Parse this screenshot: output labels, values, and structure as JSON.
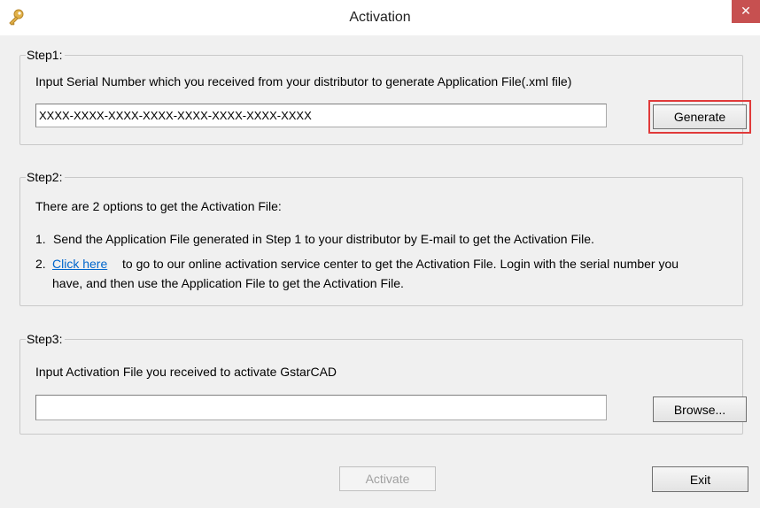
{
  "window": {
    "title": "Activation",
    "close_glyph": "✕",
    "icon": "key-icon"
  },
  "step1": {
    "legend": "Step1:",
    "instruction": "Input Serial Number which you received from your distributor to generate Application File(.xml file)",
    "serial_value": "XXXX-XXXX-XXXX-XXXX-XXXX-XXXX-XXXX-XXXX",
    "generate_label": "Generate",
    "highlight_color": "#e03a3a"
  },
  "step2": {
    "legend": "Step2:",
    "intro": "There are 2 options to get the Activation File:",
    "option1_number": "1.",
    "option1_text": "Send the Application File generated in Step 1 to your distributor by E-mail to get the Activation File.",
    "option2_number": "2.",
    "option2_link": "Click here",
    "option2_text_line1": "to go to our online activation service center to get the Activation File. Login with the serial number you",
    "option2_text_line2": "have, and then use the Application File to get the Activation File."
  },
  "step3": {
    "legend": "Step3:",
    "instruction": "Input Activation File you received to activate GstarCAD",
    "file_value": "",
    "browse_label": "Browse..."
  },
  "footer": {
    "activate_label": "Activate",
    "exit_label": "Exit"
  },
  "colors": {
    "background": "#f0f0f0",
    "link": "#0066cc",
    "close_button": "#c75050"
  }
}
